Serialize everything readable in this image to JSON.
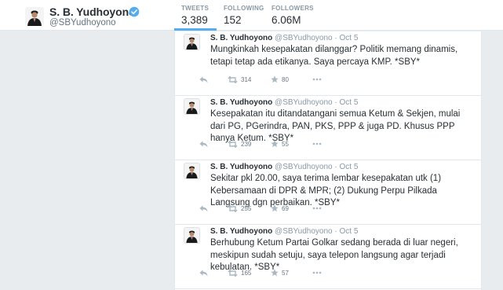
{
  "profile": {
    "name": "S. B. Yudhoyono",
    "handle": "@SBYudhoyono",
    "verified": true
  },
  "stats": [
    {
      "label": "TWEETS",
      "value": "3,389",
      "active": true
    },
    {
      "label": "FOLLOWING",
      "value": "152",
      "active": false
    },
    {
      "label": "FOLLOWERS",
      "value": "6.06M",
      "active": false
    }
  ],
  "colors": {
    "accent": "#55acee",
    "background": "#e9ecee"
  },
  "tweets": [
    {
      "name": "S. B. Yudhoyono",
      "handle": "@SBYudhoyono",
      "separator": "·",
      "date": "Oct 5",
      "text": "Mungkinkah kesepakatan dilanggar? Politik memang dinamis, tetapi tetap ada etikanya. Saya percaya KMP. *SBY*",
      "retweets": "314",
      "favorites": "80"
    },
    {
      "name": "S. B. Yudhoyono",
      "handle": "@SBYudhoyono",
      "separator": "·",
      "date": "Oct 5",
      "text": "Kesepakatan itu ditandatangani semua Ketum & Sekjen, mulai dari PG, PGerindra, PAN, PKS, PPP & juga PD. Khusus PPP hanya Ketum. *SBY*",
      "retweets": "239",
      "favorites": "55"
    },
    {
      "name": "S. B. Yudhoyono",
      "handle": "@SBYudhoyono",
      "separator": "·",
      "date": "Oct 5",
      "text": "Sekitar pkl 20.00, saya terima lembar kesepakatan utk (1) Kebersamaan di DPR & MPR; (2) Dukung Perpu Pilkada Langsung dgn perbaikan. *SBY*",
      "retweets": "255",
      "favorites": "69"
    },
    {
      "name": "S. B. Yudhoyono",
      "handle": "@SBYudhoyono",
      "separator": "·",
      "date": "Oct 5",
      "text": "Berhubung Ketum Partai Golkar sedang berada di luar negeri, meskipun sudah setuju, saya telepon langsung agar terjadi kebulatan. *SBY*",
      "retweets": "165",
      "favorites": "57"
    }
  ]
}
